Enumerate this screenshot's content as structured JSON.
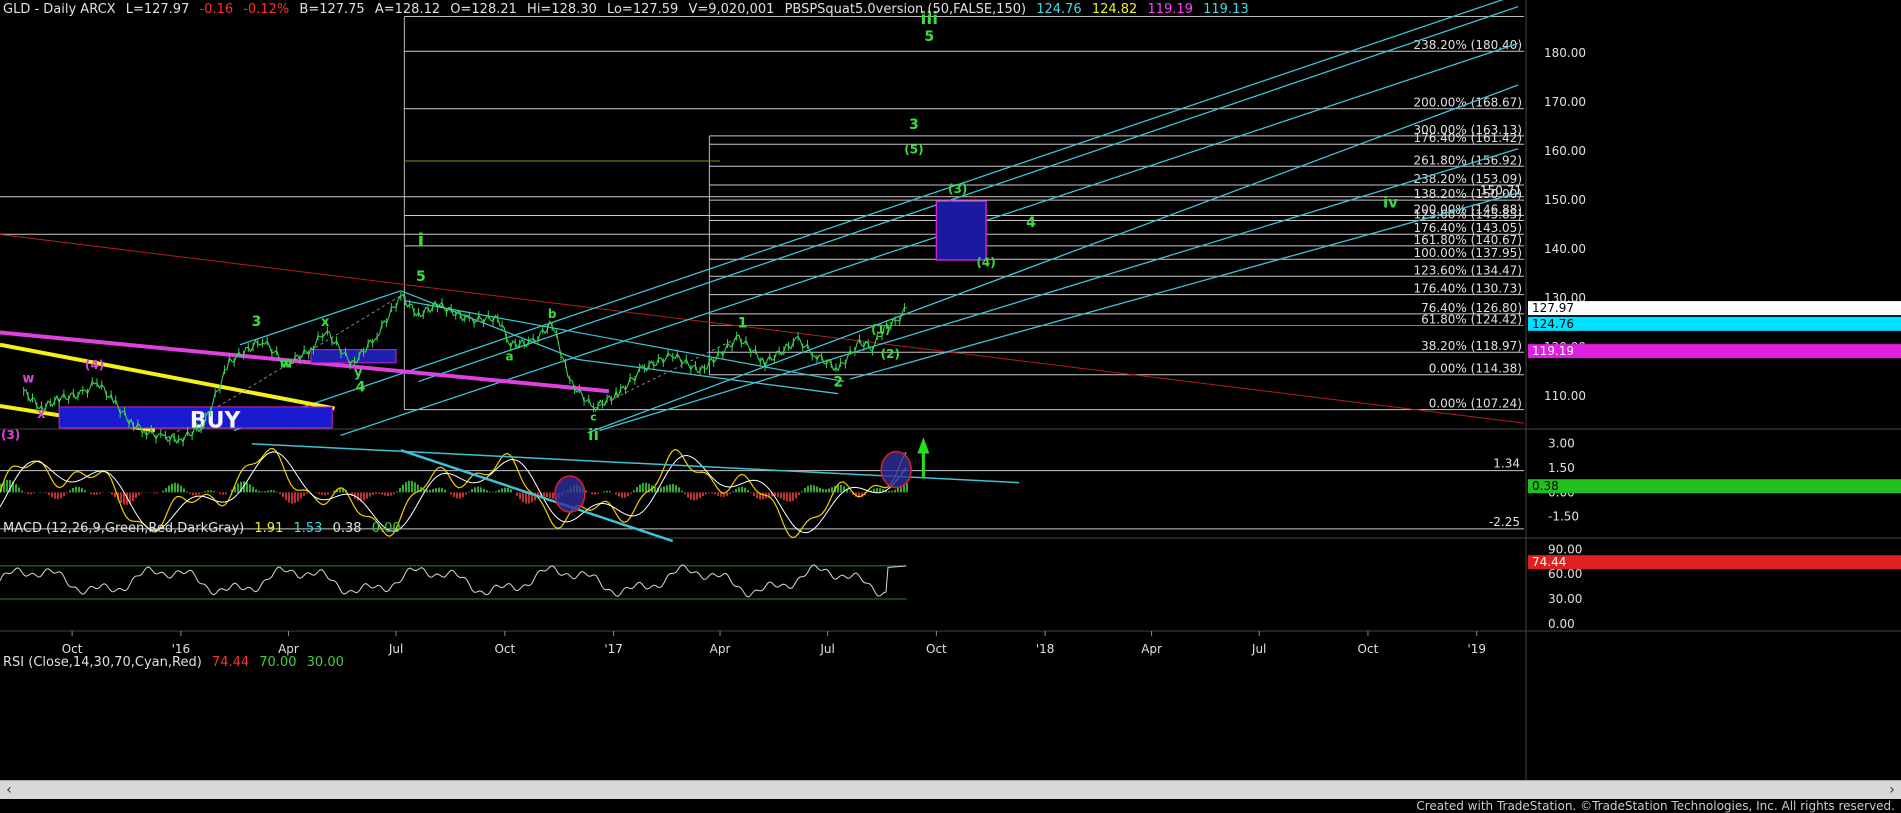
{
  "header": {
    "price": {
      "symbol": "GLD - Daily  ARCX",
      "last": "L=127.97",
      "change": "-0.16",
      "pct": "-0.12%",
      "bid": "B=127.75",
      "ask": "A=128.12",
      "open": "O=128.21",
      "high": "Hi=128.30",
      "low": "Lo=127.59",
      "volume": "V=9,020,001",
      "indicator": "PBSPSquat5.0version (50,FALSE,150)",
      "v1": "124.76",
      "v2": "124.82",
      "v3": "119.19",
      "v4": "119.13"
    },
    "macd": {
      "label": "MACD (12,26,9,Green,Red,DarkGray)",
      "v1": "1.91",
      "v2": "1.53",
      "v3": "0.38",
      "v4": "0.00"
    },
    "rsi": {
      "label": "RSI (Close,14,30,70,Cyan,Red)",
      "v1": "74.44",
      "v2": "70.00",
      "v3": "30.00"
    }
  },
  "colors": {
    "background": "#000000",
    "price": "#39d353",
    "cyan": "#3fc1d6",
    "fib": "#d0d0d0",
    "magenta": "#e040e0",
    "yellow": "#f5f018",
    "red": "#b02020",
    "wave": "#3ddc3d",
    "box": "#1a1aa0",
    "macd_line": "#f0d000",
    "signal": "#ffffff",
    "up_hist": "#2eaa2e",
    "down_hist": "#c03030"
  },
  "chart_data": {
    "type": "line",
    "title": "GLD - Daily",
    "price_axis": {
      "ticks": [
        180,
        170,
        160,
        150,
        140,
        130,
        120,
        110
      ],
      "ylim": [
        103.5,
        188
      ]
    },
    "time_axis": {
      "labels": [
        "Oct",
        "'16",
        "Apr",
        "Jul",
        "Oct",
        "'17",
        "Apr",
        "Jul",
        "Oct",
        "'18",
        "Apr",
        "Jul",
        "Oct",
        "'19"
      ]
    },
    "price_series": [
      [
        "2015-08-21",
        111.0
      ],
      [
        "2015-09-05",
        107.5
      ],
      [
        "2015-09-20",
        109.5
      ],
      [
        "2015-10-10",
        110.5
      ],
      [
        "2015-10-22",
        113.0
      ],
      [
        "2015-11-05",
        109.0
      ],
      [
        "2015-11-20",
        104.5
      ],
      [
        "2015-12-03",
        102.8
      ],
      [
        "2015-12-17",
        101.5
      ],
      [
        "2016-01-01",
        101.2
      ],
      [
        "2016-01-20",
        104.0
      ],
      [
        "2016-02-11",
        117.0
      ],
      [
        "2016-03-10",
        121.5
      ],
      [
        "2016-03-30",
        116.5
      ],
      [
        "2016-04-20",
        119.5
      ],
      [
        "2016-05-02",
        123.5
      ],
      [
        "2016-05-25",
        116.5
      ],
      [
        "2016-06-15",
        122.5
      ],
      [
        "2016-07-05",
        130.5
      ],
      [
        "2016-07-20",
        126.5
      ],
      [
        "2016-08-05",
        128.8
      ],
      [
        "2016-09-01",
        125.5
      ],
      [
        "2016-09-25",
        126.0
      ],
      [
        "2016-10-06",
        120.5
      ],
      [
        "2016-10-25",
        121.0
      ],
      [
        "2016-11-10",
        125.0
      ],
      [
        "2016-11-25",
        113.0
      ],
      [
        "2016-12-15",
        107.5
      ],
      [
        "2017-01-05",
        110.5
      ],
      [
        "2017-01-25",
        115.5
      ],
      [
        "2017-02-20",
        118.5
      ],
      [
        "2017-03-15",
        115.0
      ],
      [
        "2017-04-17",
        122.0
      ],
      [
        "2017-05-09",
        116.8
      ],
      [
        "2017-06-06",
        121.5
      ],
      [
        "2017-06-20",
        118.5
      ],
      [
        "2017-07-10",
        115.5
      ],
      [
        "2017-07-28",
        121.0
      ],
      [
        "2017-08-08",
        120.0
      ],
      [
        "2017-08-18",
        123.8
      ],
      [
        "2017-08-29",
        125.5
      ],
      [
        "2017-09-06",
        127.97
      ]
    ],
    "fib_levels": [
      {
        "label": "238.20% (180.40)",
        "value": 180.4
      },
      {
        "label": "200.00% (168.67)",
        "value": 168.67
      },
      {
        "label": "300.00% (163.13)",
        "value": 163.13
      },
      {
        "label": "176.40% (161.42)",
        "value": 161.42
      },
      {
        "label": "261.80% (156.92)",
        "value": 156.92
      },
      {
        "label": "238.20% (153.09)",
        "value": 153.09
      },
      {
        "label": "150.71",
        "value": 150.71
      },
      {
        "label": "138.20% (150.00)",
        "value": 150.0
      },
      {
        "label": "200.00% (146.88)",
        "value": 146.88
      },
      {
        "label": "123.60% (145.85)",
        "value": 145.85
      },
      {
        "label": "176.40% (143.05)",
        "value": 143.05
      },
      {
        "label": "161.80% (140.67)",
        "value": 140.67
      },
      {
        "label": "100.00% (137.95)",
        "value": 137.95
      },
      {
        "label": "123.60% (134.47)",
        "value": 134.47
      },
      {
        "label": "176.40% (130.73)",
        "value": 130.73
      },
      {
        "label": "76.40% (126.80)",
        "value": 126.8
      },
      {
        "label": "61.80% (124.42)",
        "value": 124.42
      },
      {
        "label": "38.20% (118.97)",
        "value": 118.97
      },
      {
        "label": "0.00% (114.38)",
        "value": 114.38
      },
      {
        "label": "0.00% (107.24)",
        "value": 107.24
      }
    ],
    "price_tags": [
      {
        "label": "127.97",
        "value": 127.97,
        "color": "#ffffff",
        "text": "#000000"
      },
      {
        "label": "124.76",
        "value": 124.76,
        "color": "#00e0ff",
        "text": "#000000"
      },
      {
        "label": "119.19",
        "value": 119.19,
        "color": "#e020e0",
        "text": "#ffffff"
      }
    ],
    "wave_labels": [
      {
        "text": "iii",
        "d": "2017-09-25",
        "v": 186.0,
        "size": 17,
        "color": "#3ddc3d"
      },
      {
        "text": "5",
        "d": "2017-09-25",
        "v": 182.5,
        "size": 14,
        "color": "#3ddc3d"
      },
      {
        "text": "3",
        "d": "2017-09-12",
        "v": 164.5,
        "size": 14,
        "color": "#3ddc3d"
      },
      {
        "text": "(5)",
        "d": "2017-09-12",
        "v": 159.5,
        "size": 12,
        "color": "#3ddc3d"
      },
      {
        "text": "(3)",
        "d": "2017-10-19",
        "v": 151.5,
        "size": 12,
        "color": "#3ddc3d"
      },
      {
        "text": "(4)",
        "d": "2017-11-12",
        "v": 136.5,
        "size": 12,
        "color": "#3ddc3d"
      },
      {
        "text": "4",
        "d": "2017-12-20",
        "v": 144.5,
        "size": 14,
        "color": "#3ddc3d"
      },
      {
        "text": "iv",
        "d": "2018-10-20",
        "v": 148.5,
        "size": 15,
        "color": "#3ddc3d"
      },
      {
        "text": "i",
        "d": "2016-07-22",
        "v": 140.5,
        "size": 19,
        "color": "#3ddc3d"
      },
      {
        "text": "5",
        "d": "2016-07-22",
        "v": 133.5,
        "size": 14,
        "color": "#3ddc3d"
      },
      {
        "text": "3",
        "d": "2016-03-05",
        "v": 124.3,
        "size": 14,
        "color": "#3ddc3d"
      },
      {
        "text": "x",
        "d": "2016-05-02",
        "v": 124.3,
        "size": 13,
        "color": "#3ddc3d"
      },
      {
        "text": "w",
        "d": "2016-03-30",
        "v": 115.8,
        "size": 13,
        "color": "#3ddc3d"
      },
      {
        "text": "y",
        "d": "2016-05-30",
        "v": 114.0,
        "size": 13,
        "color": "#3ddc3d"
      },
      {
        "text": "4",
        "d": "2016-06-01",
        "v": 111.0,
        "size": 14,
        "color": "#3ddc3d"
      },
      {
        "text": "b",
        "d": "2016-11-10",
        "v": 126.0,
        "size": 12,
        "color": "#3ddc3d"
      },
      {
        "text": "a",
        "d": "2016-10-05",
        "v": 117.3,
        "size": 12,
        "color": "#3ddc3d"
      },
      {
        "text": "c",
        "d": "2016-12-15",
        "v": 105.0,
        "size": 11,
        "color": "#3ddc3d"
      },
      {
        "text": "ii",
        "d": "2016-12-15",
        "v": 101.0,
        "size": 16,
        "color": "#3ddc3d"
      },
      {
        "text": "1",
        "d": "2017-04-20",
        "v": 124.0,
        "size": 14,
        "color": "#3ddc3d"
      },
      {
        "text": "2",
        "d": "2017-07-10",
        "v": 112.0,
        "size": 14,
        "color": "#3ddc3d"
      },
      {
        "text": "(1)",
        "d": "2017-08-15",
        "v": 122.8,
        "size": 12,
        "color": "#3ddc3d"
      },
      {
        "text": "(2)",
        "d": "2017-08-23",
        "v": 117.8,
        "size": 12,
        "color": "#3ddc3d"
      },
      {
        "text": "w",
        "d": "2015-08-25",
        "v": 112.8,
        "size": 13,
        "color": "#e040e0"
      },
      {
        "text": "(4)",
        "d": "2015-10-20",
        "v": 115.5,
        "size": 12,
        "color": "#e040e0"
      },
      {
        "text": "x",
        "d": "2015-09-05",
        "v": 105.5,
        "size": 13,
        "color": "#e040e0"
      },
      {
        "text": "(3)",
        "d": "2015-08-10",
        "v": 101.3,
        "size": 12,
        "color": "#e040e0"
      }
    ],
    "buy_text": "BUY",
    "macd": {
      "ticks": [
        "3.00",
        "1.50",
        "0.00",
        "-1.50"
      ],
      "levels": [
        {
          "label": "1.34",
          "value": 1.34
        },
        {
          "label": "-2.25",
          "value": -2.25
        }
      ],
      "last": "0.38",
      "ylim": [
        -2.75,
        3.6
      ]
    },
    "rsi": {
      "ticks": [
        "90.00",
        "60.00",
        "30.00",
        "0.00"
      ],
      "last": "74.44",
      "ylim": [
        -5,
        100
      ]
    }
  }
}
